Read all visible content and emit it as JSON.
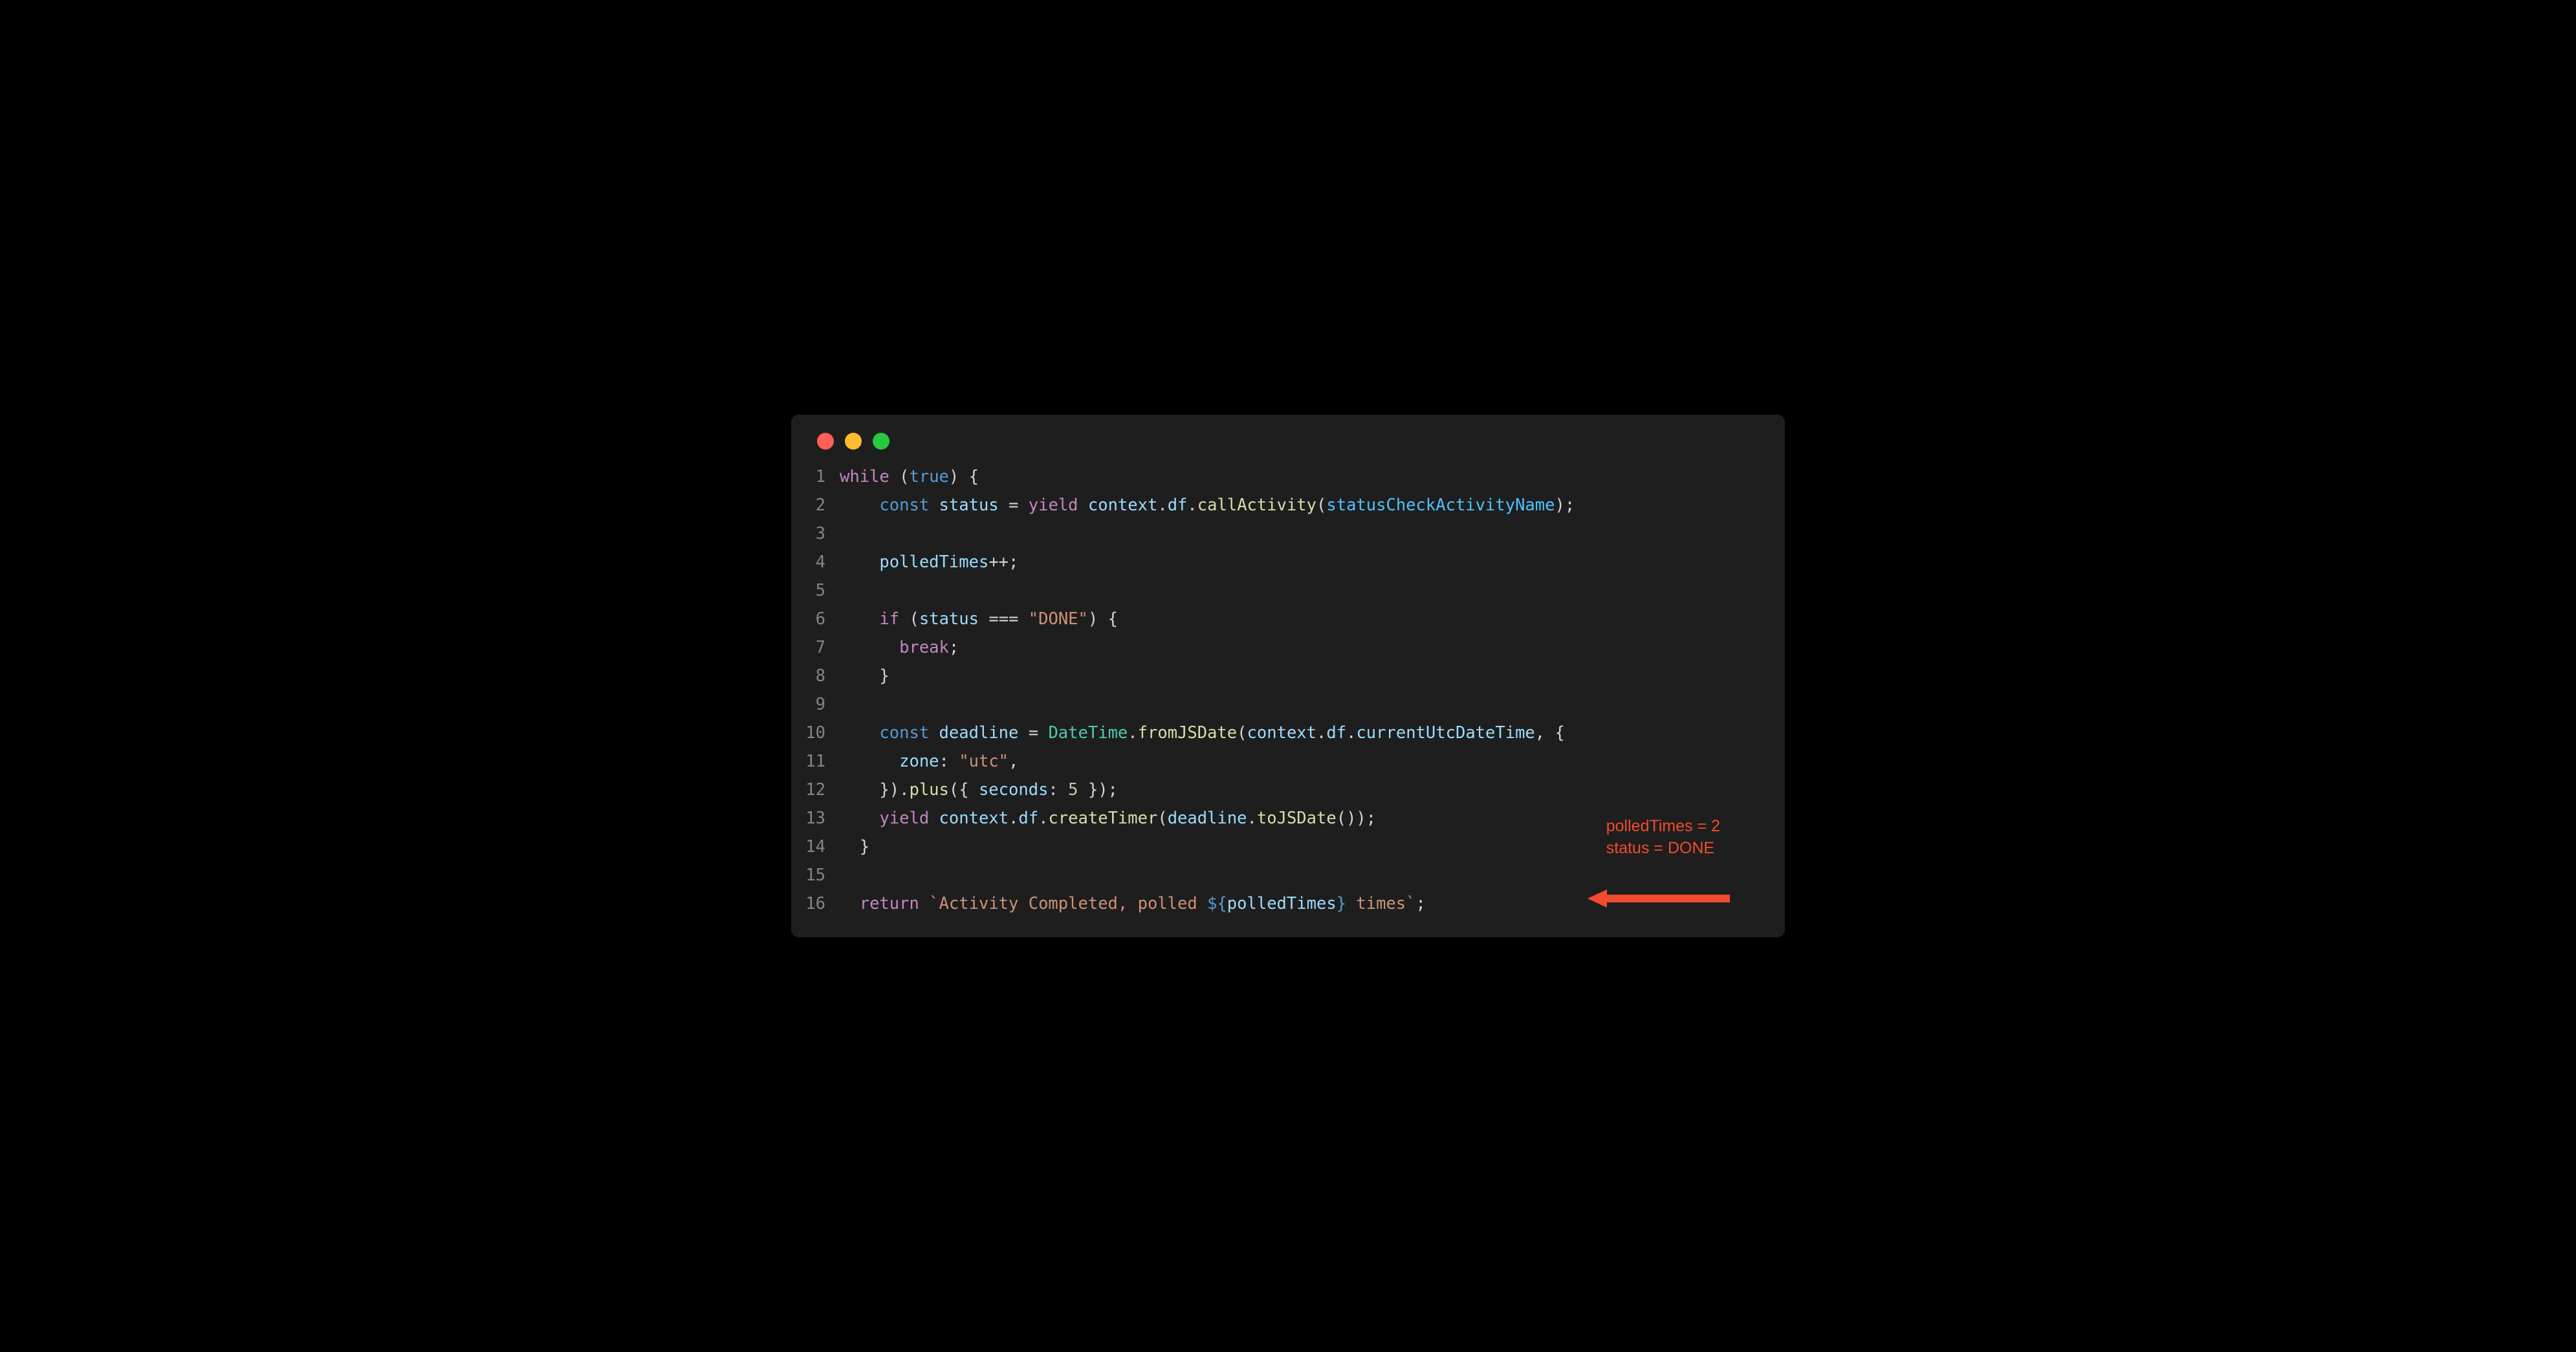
{
  "colors": {
    "background": "#1e1e1e",
    "annotation": "#f14c2e",
    "traffic_red": "#ff5f57",
    "traffic_yellow": "#febc2e",
    "traffic_green": "#28c840"
  },
  "line_numbers": [
    "1",
    "2",
    "3",
    "4",
    "5",
    "6",
    "7",
    "8",
    "9",
    "10",
    "11",
    "12",
    "13",
    "14",
    "15",
    "16"
  ],
  "code": {
    "l1": {
      "t0": "while",
      "t1": " (",
      "t2": "true",
      "t3": ") {"
    },
    "l2": {
      "t0": "    ",
      "t1": "const",
      "t2": " ",
      "t3": "status",
      "t4": " ",
      "t5": "=",
      "t6": " ",
      "t7": "yield",
      "t8": " ",
      "t9": "context",
      "t10": ".",
      "t11": "df",
      "t12": ".",
      "t13": "callActivity",
      "t14": "(",
      "t15": "statusCheckActivityName",
      "t16": ");"
    },
    "l3": {
      "t0": ""
    },
    "l4": {
      "t0": "    ",
      "t1": "polledTimes",
      "t2": "++",
      "t3": ";"
    },
    "l5": {
      "t0": ""
    },
    "l6": {
      "t0": "    ",
      "t1": "if",
      "t2": " (",
      "t3": "status",
      "t4": " ",
      "t5": "===",
      "t6": " ",
      "t7": "\"DONE\"",
      "t8": ") {"
    },
    "l7": {
      "t0": "      ",
      "t1": "break",
      "t2": ";"
    },
    "l8": {
      "t0": "    }"
    },
    "l9": {
      "t0": ""
    },
    "l10": {
      "t0": "    ",
      "t1": "const",
      "t2": " ",
      "t3": "deadline",
      "t4": " ",
      "t5": "=",
      "t6": " ",
      "t7": "DateTime",
      "t8": ".",
      "t9": "fromJSDate",
      "t10": "(",
      "t11": "context",
      "t12": ".",
      "t13": "df",
      "t14": ".",
      "t15": "currentUtcDateTime",
      "t16": ", {"
    },
    "l11": {
      "t0": "      ",
      "t1": "zone",
      "t2": ":",
      "t3": " ",
      "t4": "\"utc\"",
      "t5": ","
    },
    "l12": {
      "t0": "    }).",
      "t1": "plus",
      "t2": "({ ",
      "t3": "seconds",
      "t4": ":",
      "t5": " ",
      "t6": "5",
      "t7": " });"
    },
    "l13": {
      "t0": "    ",
      "t1": "yield",
      "t2": " ",
      "t3": "context",
      "t4": ".",
      "t5": "df",
      "t6": ".",
      "t7": "createTimer",
      "t8": "(",
      "t9": "deadline",
      "t10": ".",
      "t11": "toJSDate",
      "t12": "());"
    },
    "l14": {
      "t0": "  }"
    },
    "l15": {
      "t0": ""
    },
    "l16": {
      "t0": "  ",
      "t1": "return",
      "t2": " ",
      "t3": "`Activity Completed, polled ",
      "t4": "${",
      "t5": "polledTimes",
      "t6": "}",
      "t7": " times`",
      "t8": ";"
    }
  },
  "annotation": {
    "line1": "polledTimes = 2",
    "line2": "status = DONE"
  }
}
